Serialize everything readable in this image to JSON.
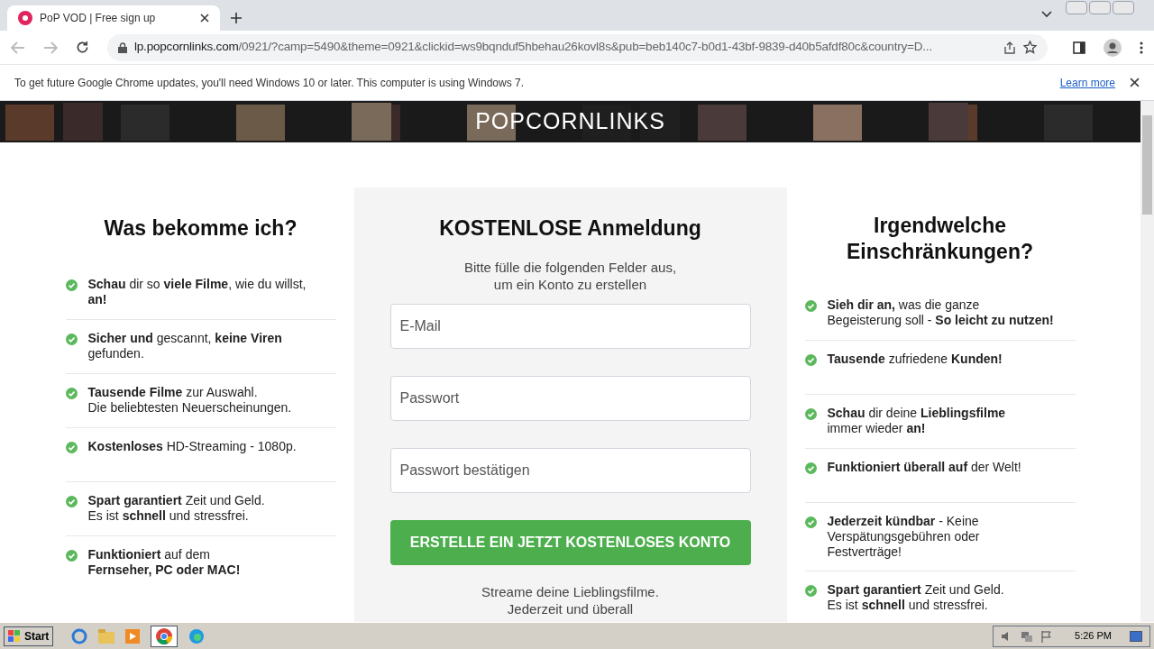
{
  "browser": {
    "tab_title": "PoP VOD | Free sign up",
    "url_host": "lp.popcornlinks.com",
    "url_path": "/0921/?camp=5490&theme=0921&clickid=ws9bqnduf5hbehau26kovl8s&pub=beb140c7-b0d1-43bf-9839-d40b5afdf80c&country=D...",
    "infobar": "To get future Google Chrome updates, you'll need Windows 10 or later. This computer is using Windows 7.",
    "infobar_link": "Learn more"
  },
  "logo": "POPCORNLINKS",
  "left": {
    "title": "Was bekomme ich?",
    "items": [
      "**Schau** dir so **viele Filme**, wie du willst,\n**an!**",
      "**Sicher und** gescannt, **keine Viren**\ngefunden.",
      "**Tausende Filme** zur Auswahl.\nDie beliebtesten Neuerscheinungen.",
      "**Kostenloses** HD-Streaming - 1080p.",
      "**Spart garantiert** Zeit und Geld.\nEs ist **schnell** und stressfrei.",
      "**Funktioniert** auf dem\n**Fernseher, PC oder MAC!**"
    ]
  },
  "form": {
    "title": "KOSTENLOSE Anmeldung",
    "subtitle": "Bitte fülle die folgenden Felder aus,\num ein Konto zu erstellen",
    "fields": [
      {
        "placeholder": "E-Mail"
      },
      {
        "placeholder": "Passwort"
      },
      {
        "placeholder": "Passwort bestätigen"
      }
    ],
    "button": "ERSTELLE EIN JETZT KOSTENLOSES KONTO",
    "footer": "Streame deine Lieblingsfilme.\nJederzeit und überall"
  },
  "right": {
    "title": "Irgendwelche\nEinschränkungen?",
    "items": [
      "**Sieh dir an,** was die ganze\nBegeisterung soll - **So leicht zu nutzen!**",
      "**Tausende** zufriedene **Kunden!**",
      "**Schau** dir deine **Lieblingsfilme**\nimmer wieder **an!**",
      "**Funktioniert überall auf** der Welt!",
      "**Jederzeit kündbar** - Keine\nVerspätungsgebühren oder\nFestverträge!",
      "**Spart garantiert** Zeit und Geld.\nEs ist **schnell** und stressfrei."
    ]
  },
  "taskbar": {
    "start": "Start",
    "clock": "5:26 PM"
  }
}
